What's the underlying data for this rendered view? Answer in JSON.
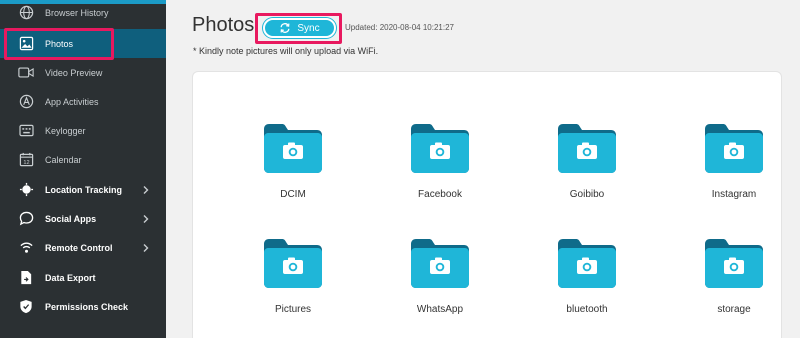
{
  "sidebar": {
    "items": [
      {
        "label": "Browser History",
        "icon": "globe-icon"
      },
      {
        "label": "Photos",
        "icon": "image-icon"
      },
      {
        "label": "Video Preview",
        "icon": "video-icon"
      },
      {
        "label": "App Activities",
        "icon": "app-icon"
      },
      {
        "label": "Keylogger",
        "icon": "keyboard-icon"
      },
      {
        "label": "Calendar",
        "icon": "calendar-icon"
      },
      {
        "label": "Location Tracking",
        "icon": "location-icon"
      },
      {
        "label": "Social Apps",
        "icon": "chat-icon"
      },
      {
        "label": "Remote Control",
        "icon": "remote-icon"
      },
      {
        "label": "Data Export",
        "icon": "export-icon"
      },
      {
        "label": "Permissions Check",
        "icon": "shield-icon"
      }
    ],
    "active": "Photos"
  },
  "header": {
    "title": "Photos",
    "sync_label": "Sync",
    "updated": "Updated: 2020-08-04 10:21:27",
    "note": "* Kindly note pictures will only upload via WiFi."
  },
  "folders": [
    "DCIM",
    "Facebook",
    "Goibibo",
    "Instagram",
    "Pictures",
    "WhatsApp",
    "bluetooth",
    "storage"
  ],
  "colors": {
    "sidebar_bg": "#2b3033",
    "active_bg": "#0f5f7d",
    "highlight": "#e8195f",
    "accent": "#1fb6d8",
    "folder_front": "#1fb6d8",
    "folder_back": "#0f6b8a"
  }
}
